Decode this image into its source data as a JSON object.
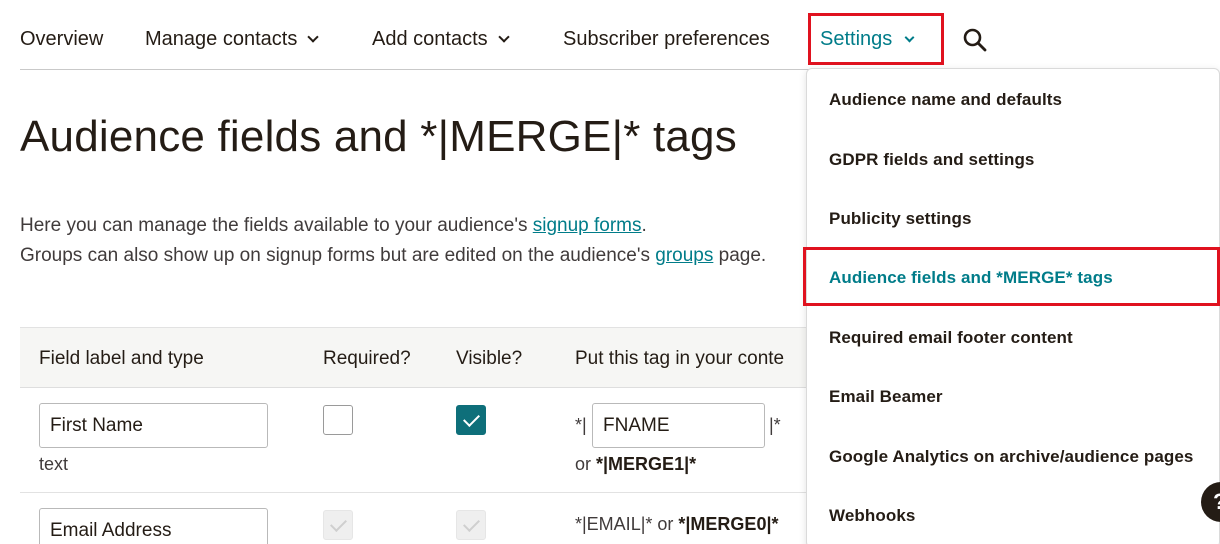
{
  "nav": {
    "items": [
      {
        "label": "Overview"
      },
      {
        "label": "Manage contacts"
      },
      {
        "label": "Add contacts"
      },
      {
        "label": "Subscriber preferences"
      },
      {
        "label": "Settings"
      }
    ],
    "search_icon": "search-icon",
    "accent_color": "#007c89",
    "highlight_color": "#e0121f"
  },
  "page": {
    "title": "Audience fields and *|MERGE|* tags",
    "intro_1_pre": "Here you can manage the fields available to your audience's ",
    "intro_1_link": "signup forms",
    "intro_1_post": ".",
    "intro_2_pre": "Groups can also show up on signup forms but are edited on the audience's ",
    "intro_2_link": "groups",
    "intro_2_post": " page."
  },
  "table": {
    "headers": [
      "Field label and type",
      "Required?",
      "Visible?",
      "Put this tag in your conte"
    ],
    "rows": [
      {
        "label": "First Name",
        "type": "text",
        "required": false,
        "visible": true,
        "tag_prefix": "*|",
        "tag": "FNAME",
        "tag_suffix": "|*",
        "alt_prefix": "or ",
        "alt": "*|MERGE1|*"
      },
      {
        "label": "Email Address",
        "type": "",
        "required": true,
        "visible": true,
        "tag_text": "*|EMAIL|* or ",
        "alt": "*|MERGE0|*"
      }
    ]
  },
  "settings_menu": {
    "items": [
      {
        "label": "Audience name and defaults"
      },
      {
        "label": "GDPR fields and settings"
      },
      {
        "label": "Publicity settings"
      },
      {
        "label": "Audience fields and *MERGE* tags",
        "active": true
      },
      {
        "label": "Required email footer content"
      },
      {
        "label": "Email Beamer"
      },
      {
        "label": "Google Analytics on archive/audience pages"
      },
      {
        "label": "Webhooks"
      }
    ]
  },
  "help": {
    "label": "?"
  }
}
